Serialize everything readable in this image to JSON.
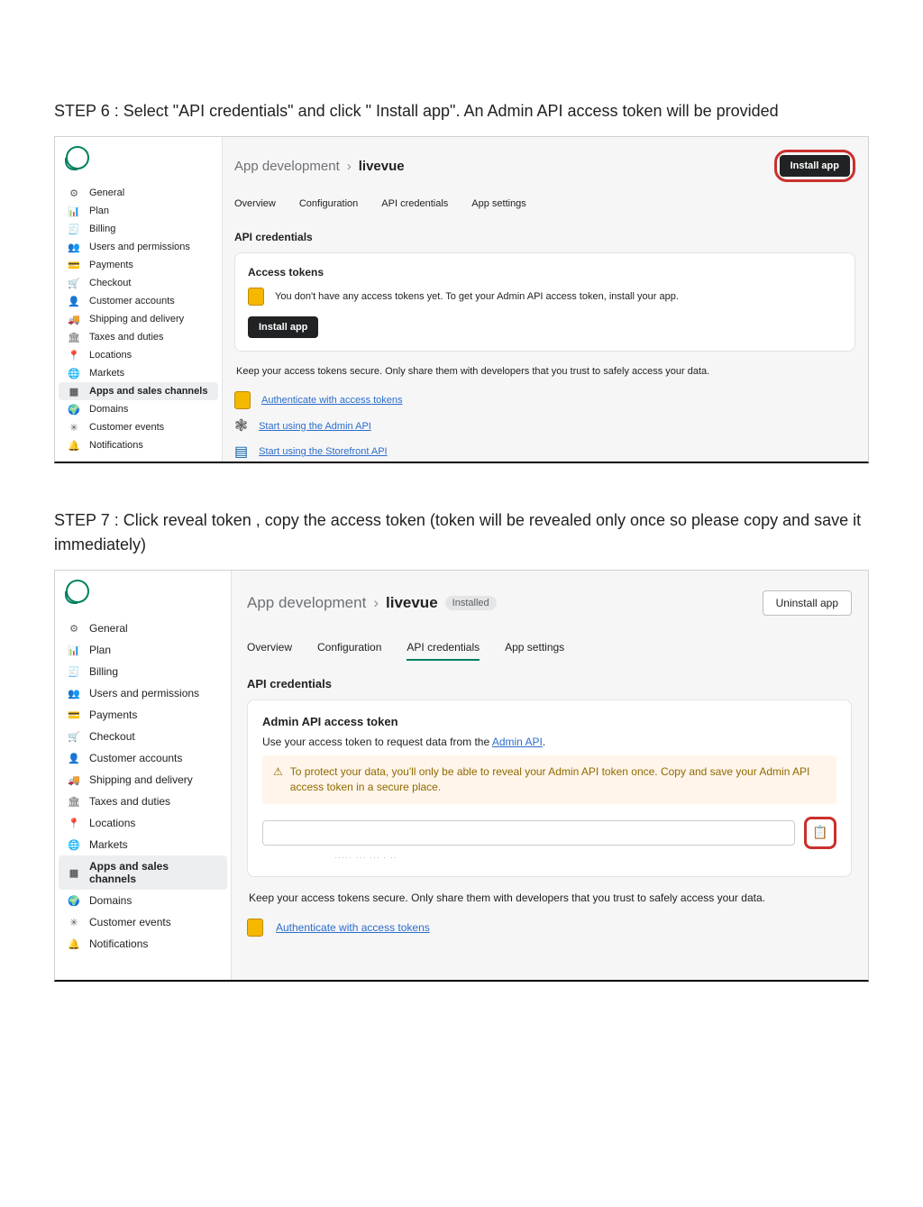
{
  "steps": {
    "s6": "STEP 6 : Select \"API credentials\" and click \" Install app\". An Admin API access token will be provided",
    "s7": "STEP 7 : Click reveal token , copy the access token (token will be revealed only once so please copy and save it immediately)"
  },
  "sidebar": {
    "items": [
      {
        "label": "General",
        "icon": "⚙"
      },
      {
        "label": "Plan",
        "icon": "📊"
      },
      {
        "label": "Billing",
        "icon": "🧾"
      },
      {
        "label": "Users and permissions",
        "icon": "👥"
      },
      {
        "label": "Payments",
        "icon": "💳"
      },
      {
        "label": "Checkout",
        "icon": "🛒"
      },
      {
        "label": "Customer accounts",
        "icon": "👤"
      },
      {
        "label": "Shipping and delivery",
        "icon": "🚚"
      },
      {
        "label": "Taxes and duties",
        "icon": "🏛"
      },
      {
        "label": "Locations",
        "icon": "📍"
      },
      {
        "label": "Markets",
        "icon": "🌐"
      },
      {
        "label": "Apps and sales channels",
        "icon": "▦"
      },
      {
        "label": "Domains",
        "icon": "🌍"
      },
      {
        "label": "Customer events",
        "icon": "✳"
      },
      {
        "label": "Notifications",
        "icon": "🔔"
      }
    ]
  },
  "header": {
    "crumb": "App development",
    "chev": "›",
    "app": "livevue",
    "installed": "Installed",
    "install": "Install app",
    "uninstall": "Uninstall app"
  },
  "tabs": {
    "overview": "Overview",
    "config": "Configuration",
    "cred": "API credentials",
    "settings": "App settings"
  },
  "panel1": {
    "sec": "API credentials",
    "accessTokens": "Access tokens",
    "empty": "You don't have any access tokens yet. To get your Admin API access token, install your app.",
    "install": "Install app",
    "note": "Keep your access tokens secure. Only share them with developers that you trust to safely access your data.",
    "link1": "Authenticate with access tokens",
    "link2": "Start using the Admin API",
    "link3": "Start using the Storefront API"
  },
  "panel2": {
    "sec": "API credentials",
    "title": "Admin API access token",
    "desc_a": "Use your access token to request data from the ",
    "desc_link": "Admin API",
    "desc_b": ".",
    "warn_icon": "⚠",
    "warn": "To protect your data, you'll only be able to reveal your Admin API token once. Copy and save your Admin API access token in a secure place.",
    "copy_icon": "📋",
    "note": "Keep your access tokens secure. Only share them with developers that you trust to safely access your data.",
    "link1": "Authenticate with access tokens"
  }
}
